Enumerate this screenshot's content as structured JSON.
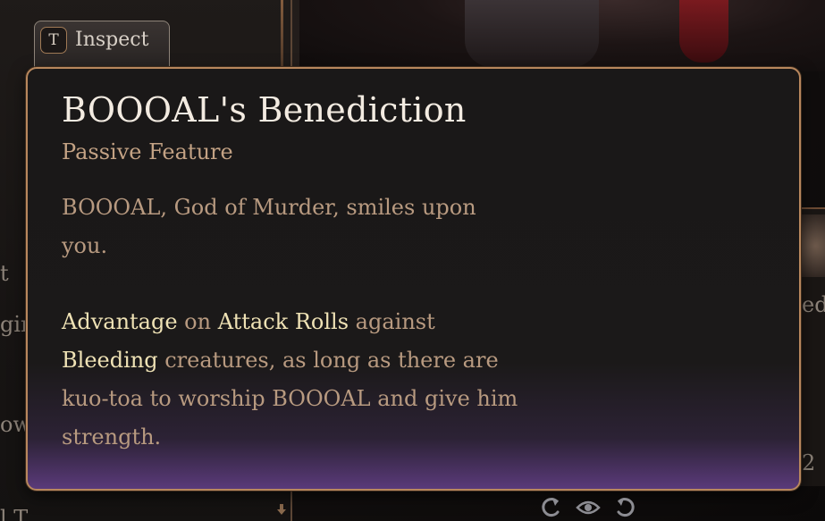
{
  "inspect_button": {
    "key": "T",
    "label": "Inspect"
  },
  "tooltip": {
    "title": "BOOOAL's Benediction",
    "subtitle": "Passive Feature",
    "description": "BOOOAL, God of Murder, smiles upon you.",
    "effect": {
      "kw_advantage": "Advantage",
      "text_on": " on ",
      "kw_attack_rolls": "Attack Rolls",
      "text_against": " against ",
      "kw_bleeding": "Bleeding",
      "text_rest": " creatures, as long as there are kuo-toa to worship BOOOAL and give him strength."
    }
  },
  "background_fragments": {
    "left_1": "t",
    "left_2": "gin",
    "left_3": "ow",
    "left_4": "l T",
    "right_1": "ed",
    "right_2": "2"
  },
  "controls": {
    "rotate_left": "rotate-left-icon",
    "view": "eye-icon",
    "rotate_right": "rotate-right-icon"
  },
  "colors": {
    "tooltip_border": "#b8875d",
    "title": "#f3ebe1",
    "subtitle": "#c3a284",
    "body_text": "#b89a80",
    "keyword": "#efe2b5",
    "bottom_glow": "#5a3a7a"
  }
}
